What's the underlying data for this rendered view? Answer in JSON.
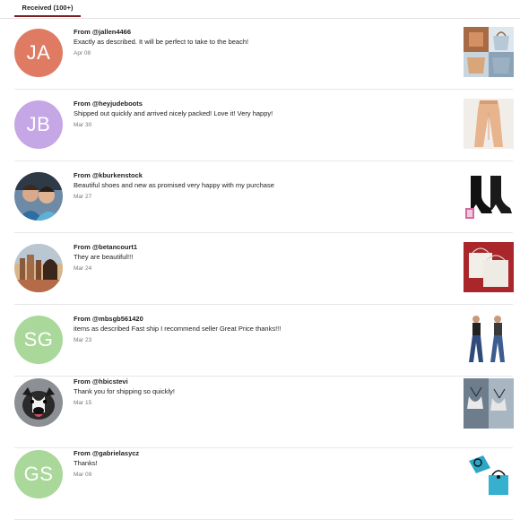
{
  "tabs": {
    "received_label": "Received (100+)"
  },
  "reviews": [
    {
      "avatar_initials": "JA",
      "avatar_color": "#e07b63",
      "from": "From @jallen4466",
      "message": "Exactly as described. It will be perfect to take to the beach!",
      "date": "Apr 08"
    },
    {
      "avatar_initials": "JB",
      "avatar_color": "#c6a7e6",
      "from": "From @heyjudeboots",
      "message": "Shipped out quickly and arrived nicely packed! Love it! Very happy!",
      "date": "Mar 30"
    },
    {
      "avatar_initials": "",
      "avatar_color": "#6d8aa6",
      "from": "From @kburkenstock",
      "message": "Beautiful shoes and new as promised very happy with my purchase",
      "date": "Mar 27"
    },
    {
      "avatar_initials": "",
      "avatar_color": "#b08a6a",
      "from": "From @betancourt1",
      "message": "They are beautiful!!!",
      "date": "Mar 24"
    },
    {
      "avatar_initials": "SG",
      "avatar_color": "#a9d89a",
      "from": "From @mbsgb561420",
      "message": "items as described Fast ship I recommend seller Great Price thanks!!!",
      "date": "Mar 23"
    },
    {
      "avatar_initials": "",
      "avatar_color": "#4a4a4a",
      "from": "From @hbicstevi",
      "message": "Thank you for shipping so quickly!",
      "date": "Mar 15"
    },
    {
      "avatar_initials": "GS",
      "avatar_color": "#a9d89a",
      "from": "From @gabrielasycz",
      "message": "Thanks!",
      "date": "Mar 09"
    }
  ]
}
